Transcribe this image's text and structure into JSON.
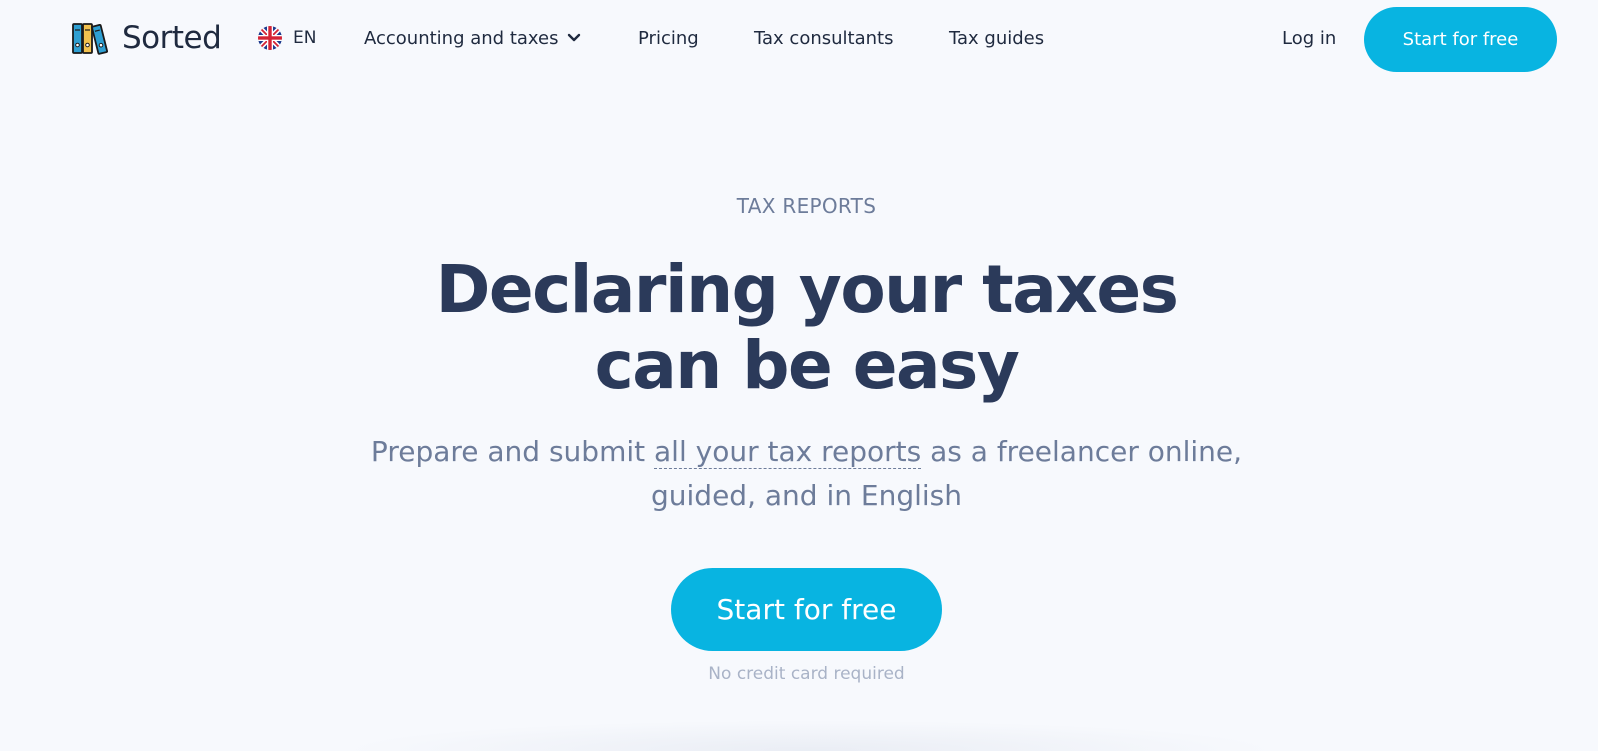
{
  "header": {
    "brand": "Sorted",
    "language": "EN",
    "nav": [
      {
        "label": "Accounting and taxes",
        "has_dropdown": true
      },
      {
        "label": "Pricing"
      },
      {
        "label": "Tax consultants"
      },
      {
        "label": "Tax guides"
      }
    ],
    "login_label": "Log in",
    "cta_label": "Start for free"
  },
  "hero": {
    "eyebrow": "TAX REPORTS",
    "headline_line1": "Declaring your taxes",
    "headline_line2": "can be easy",
    "sub_before": "Prepare and submit ",
    "sub_link": "all your tax reports",
    "sub_after_line1": " as a freelancer online,",
    "sub_line2": "guided, and in English",
    "cta_label": "Start for free",
    "note": "No credit card required"
  },
  "icons": {
    "logo": "binders-logo-icon",
    "flag": "uk-flag-icon",
    "dropdown": "chevron-down-icon"
  },
  "colors": {
    "accent": "#08b4e1",
    "heading": "#2b3a5a",
    "muted": "#6d7c9a",
    "background": "#f7f9fd"
  }
}
